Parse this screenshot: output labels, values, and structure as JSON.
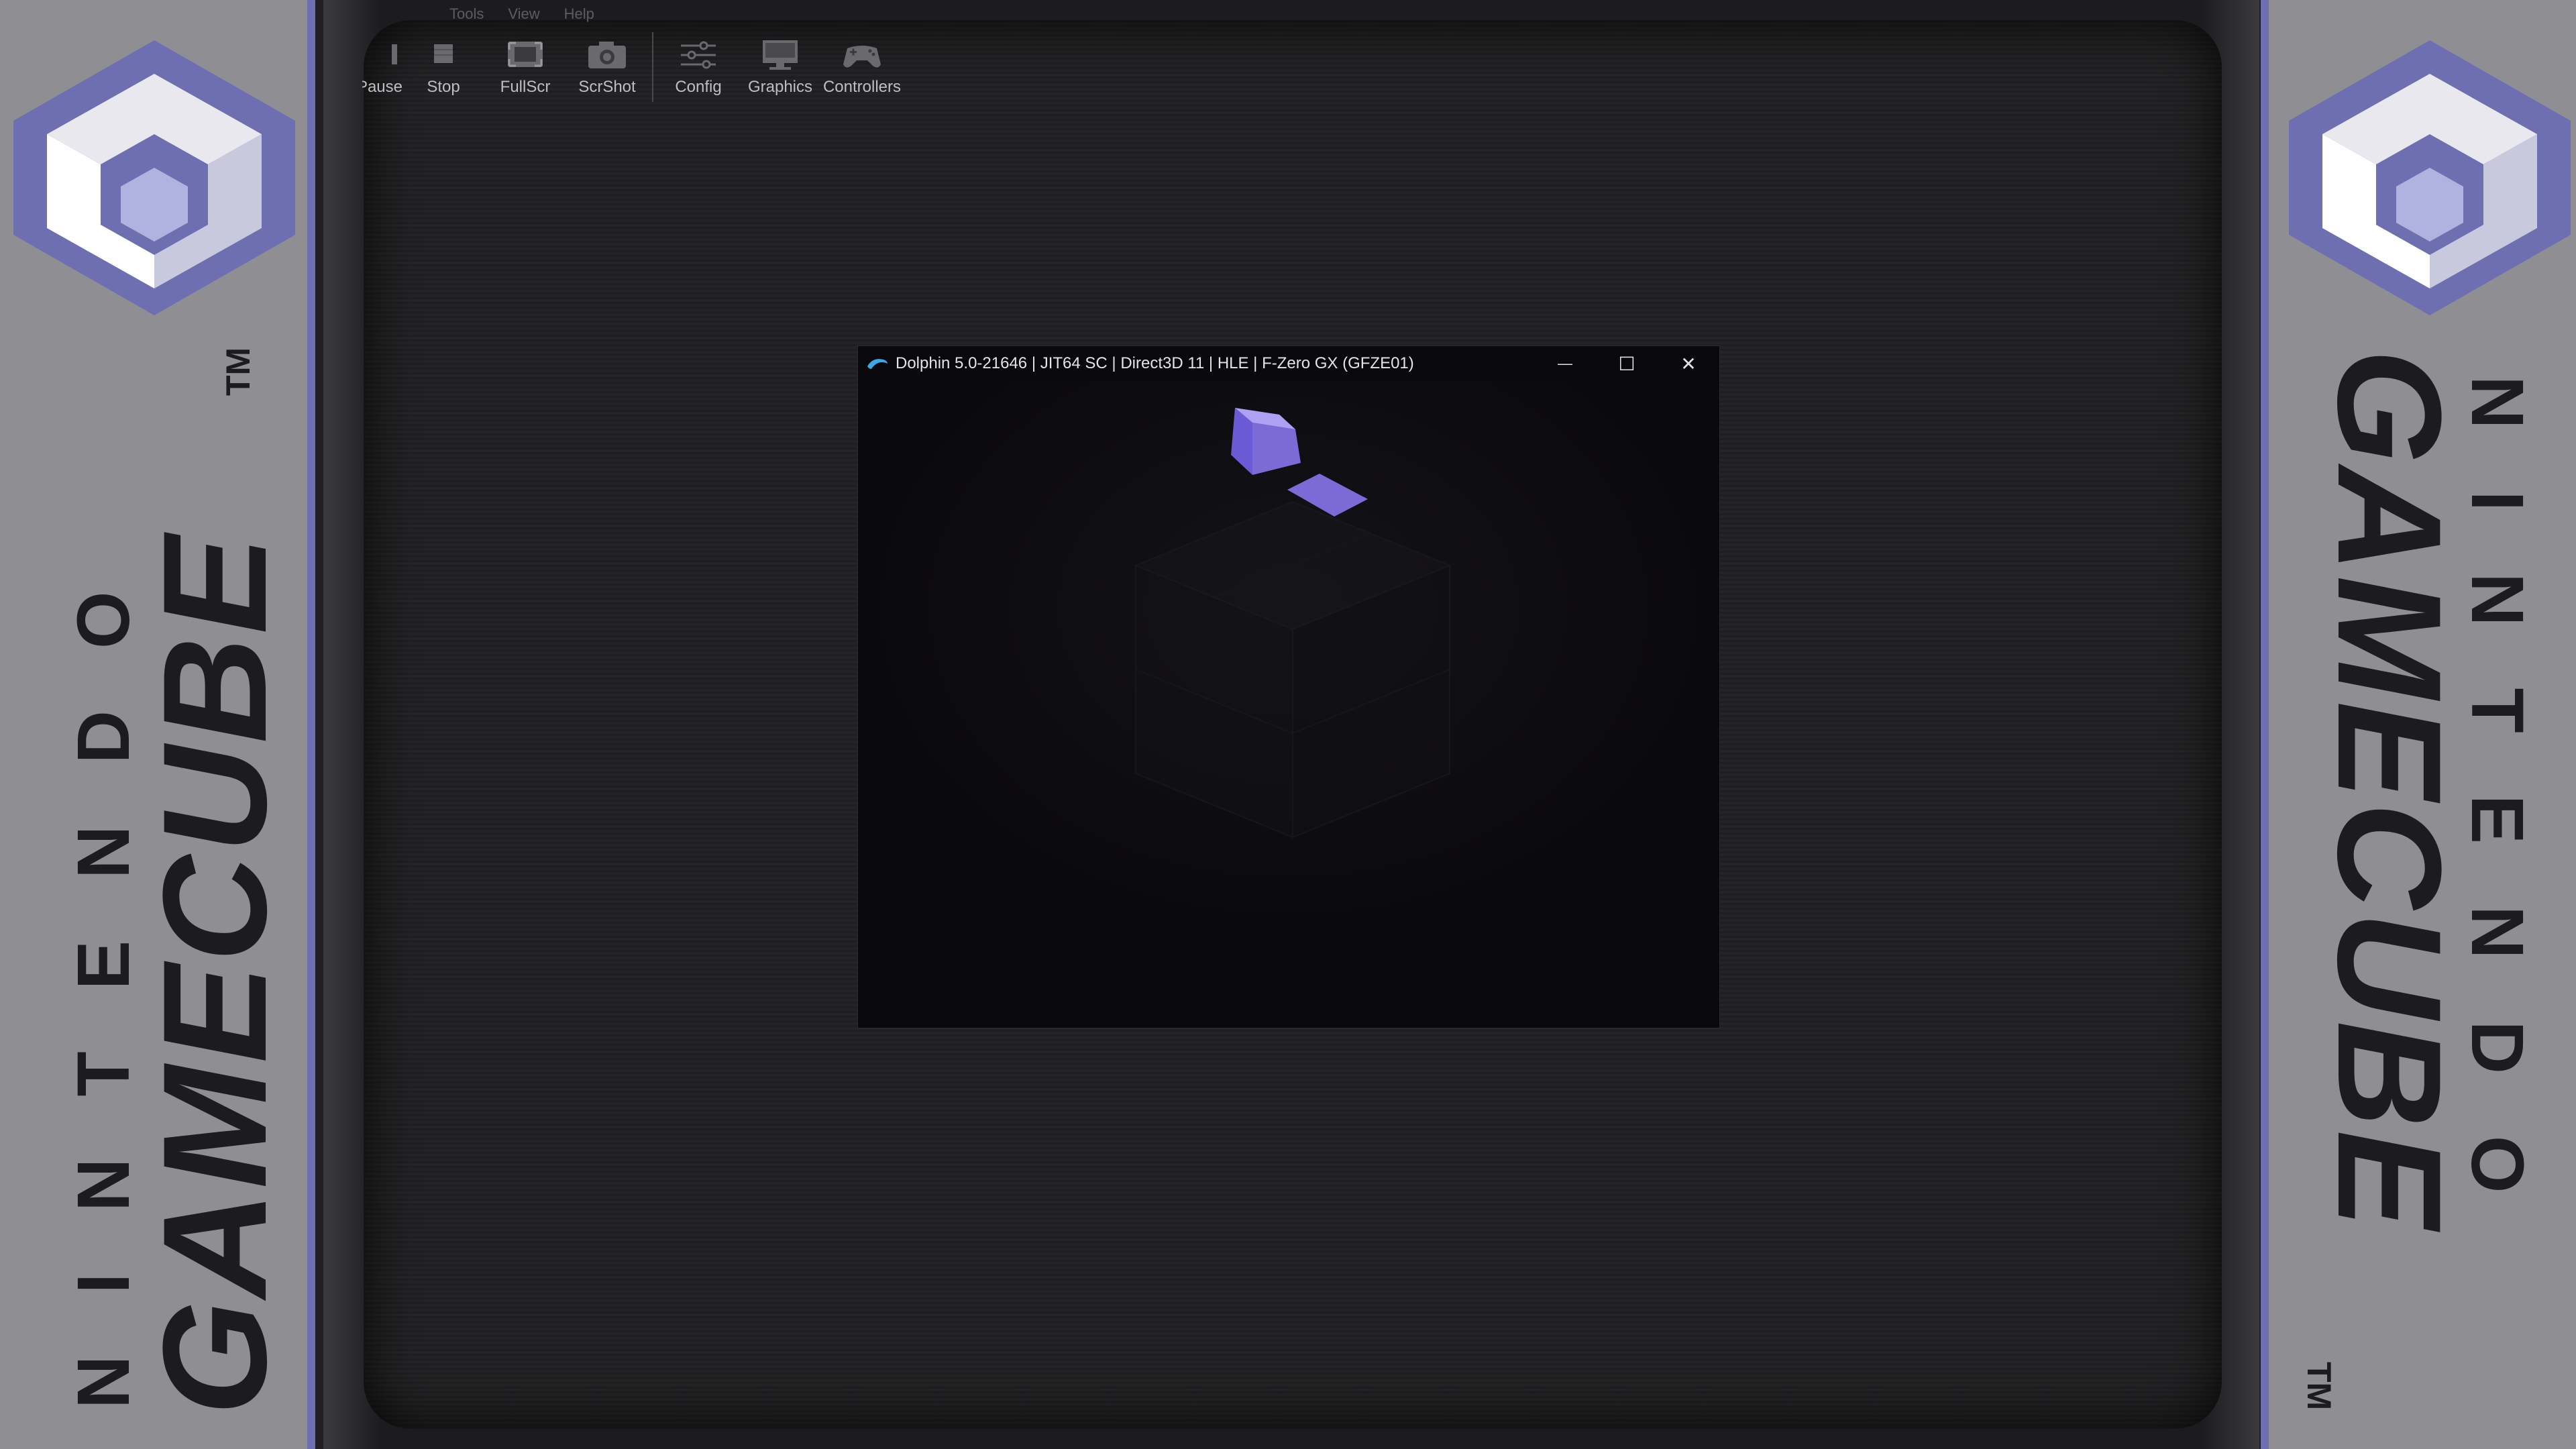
{
  "bezel": {
    "brand_small": "NINTENDO",
    "brand_big": "GAMECUBE",
    "tm": "TM",
    "accent_color": "#6d6fb0"
  },
  "menubar": {
    "items": [
      "Tools",
      "View",
      "Help"
    ]
  },
  "toolbar": {
    "buttons": [
      {
        "label": "Pause",
        "icon": "pause-icon"
      },
      {
        "label": "Stop",
        "icon": "stop-icon"
      },
      {
        "label": "FullScr",
        "icon": "fullscreen-icon"
      },
      {
        "label": "ScrShot",
        "icon": "camera-icon"
      },
      {
        "label": "Config",
        "icon": "sliders-icon"
      },
      {
        "label": "Graphics",
        "icon": "monitor-icon"
      },
      {
        "label": "Controllers",
        "icon": "gamepad-icon"
      }
    ]
  },
  "emulator_window": {
    "title": "Dolphin 5.0-21646 | JIT64 SC | Direct3D 11 | HLE | F-Zero GX (GFZE01)",
    "minimize": "—",
    "maximize": "☐",
    "close": "✕",
    "cube_color": "#7c6bd6"
  }
}
